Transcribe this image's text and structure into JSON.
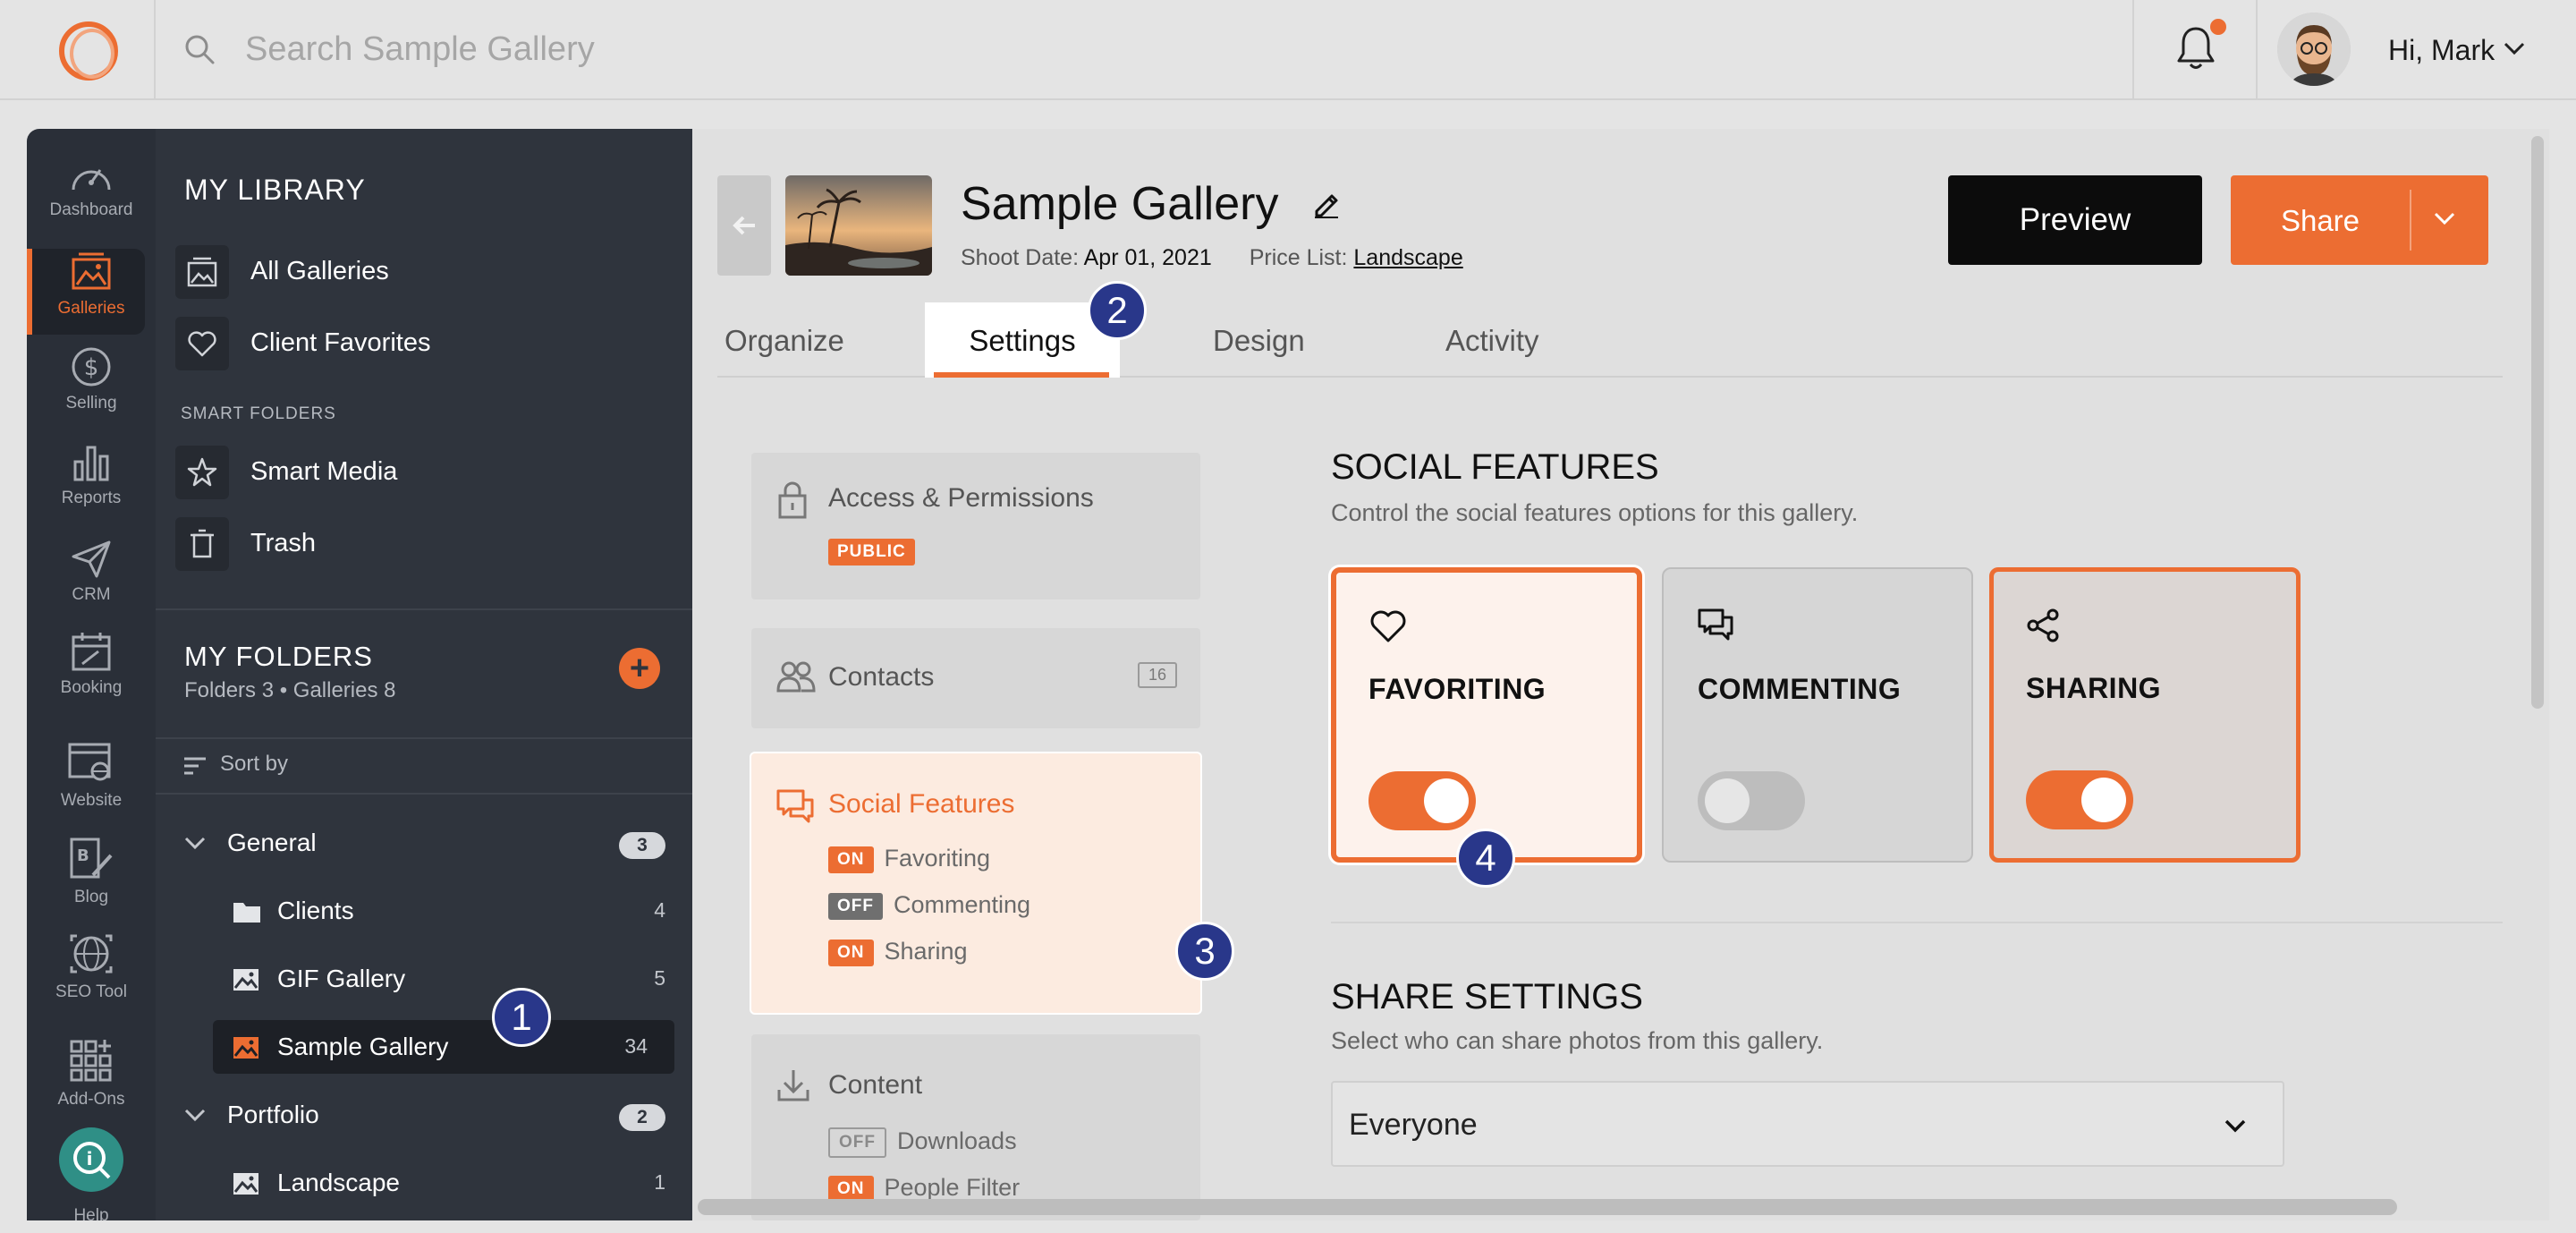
{
  "search": {
    "placeholder": "Search Sample Gallery"
  },
  "user": {
    "greeting": "Hi, Mark"
  },
  "rail": {
    "items": [
      {
        "label": "Dashboard",
        "icon": "gauge-icon"
      },
      {
        "label": "Galleries",
        "icon": "galleries-icon"
      },
      {
        "label": "Selling",
        "icon": "dollar-icon"
      },
      {
        "label": "Reports",
        "icon": "bar-chart-icon"
      },
      {
        "label": "CRM",
        "icon": "paper-plane-icon"
      },
      {
        "label": "Booking",
        "icon": "calendar-icon"
      },
      {
        "label": "Website",
        "icon": "website-icon"
      },
      {
        "label": "Blog",
        "icon": "blog-icon"
      },
      {
        "label": "SEO Tool",
        "icon": "globe-icon"
      },
      {
        "label": "Add-Ons",
        "icon": "grid-icon"
      },
      {
        "label": "Help",
        "icon": "help-icon"
      }
    ]
  },
  "library": {
    "heading": "MY LIBRARY",
    "items": [
      {
        "label": "All Galleries",
        "icon": "galleries-icon"
      },
      {
        "label": "Client Favorites",
        "icon": "heart-icon"
      }
    ],
    "smart_heading": "SMART FOLDERS",
    "smart_items": [
      {
        "label": "Smart Media",
        "icon": "star-icon"
      },
      {
        "label": "Trash",
        "icon": "trash-icon"
      }
    ]
  },
  "folders": {
    "heading": "MY FOLDERS",
    "meta": "Folders 3 • Galleries 8",
    "sort_label": "Sort by",
    "tree": [
      {
        "label": "General",
        "count": "3"
      },
      {
        "label": "Clients",
        "count": "4"
      },
      {
        "label": "GIF Gallery",
        "count": "5"
      },
      {
        "label": "Sample Gallery",
        "count": "34"
      },
      {
        "label": "Portfolio",
        "count": "2"
      },
      {
        "label": "Landscape",
        "count": "1"
      }
    ]
  },
  "gallery": {
    "title": "Sample Gallery",
    "shoot_date_label": "Shoot Date:",
    "shoot_date": "Apr 01, 2021",
    "price_list_label": "Price List:",
    "price_list": "Landscape",
    "preview_label": "Preview",
    "share_label": "Share"
  },
  "tabs": [
    {
      "label": "Organize"
    },
    {
      "label": "Settings"
    },
    {
      "label": "Design"
    },
    {
      "label": "Activity"
    }
  ],
  "settings_nav": {
    "access": {
      "title": "Access & Permissions",
      "badge": "PUBLIC"
    },
    "contacts": {
      "title": "Contacts",
      "count": "16"
    },
    "social": {
      "title": "Social Features",
      "rows": [
        {
          "state": "ON",
          "label": "Favoriting"
        },
        {
          "state": "OFF",
          "label": "Commenting"
        },
        {
          "state": "ON",
          "label": "Sharing"
        }
      ]
    },
    "content": {
      "title": "Content",
      "rows": [
        {
          "state": "OFF",
          "label": "Downloads"
        },
        {
          "state": "ON",
          "label": "People Filter"
        }
      ]
    }
  },
  "social_features": {
    "heading": "SOCIAL FEATURES",
    "subheading": "Control the social features options for this gallery.",
    "cards": [
      {
        "label": "FAVORITING",
        "icon": "heart-icon",
        "enabled": true
      },
      {
        "label": "COMMENTING",
        "icon": "comment-icon",
        "enabled": false
      },
      {
        "label": "SHARING",
        "icon": "share-icon",
        "enabled": true
      }
    ]
  },
  "share_settings": {
    "heading": "SHARE SETTINGS",
    "subheading": "Select who can share photos from this gallery.",
    "selected": "Everyone"
  },
  "markers": [
    "1",
    "2",
    "3",
    "4"
  ],
  "colors": {
    "accent": "#ec6d32",
    "marker": "#29378a",
    "sidebar": "#2f343d",
    "rail": "#2a2f38"
  }
}
